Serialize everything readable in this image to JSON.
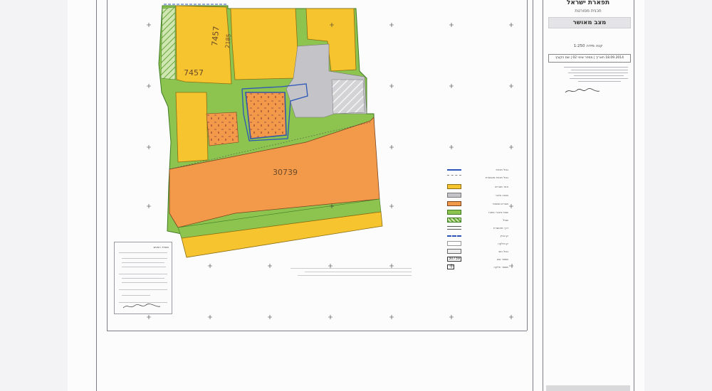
{
  "title_block": {
    "country": "תפארת ישראל",
    "plan_type": "תכנית מפורטת",
    "status": "מצב מאושר",
    "scale": "קנה מידה 1:250",
    "date_row": "18.09.2014 תאריך | מספר שינוי 02 | שם הקובץ"
  },
  "map": {
    "parcels": [
      "7457",
      "7457",
      "2185",
      "30739"
    ],
    "land_use_colors": {
      "residential": "#f5c52e",
      "public": "#c4c4c7",
      "mixed": "#f5993d",
      "open_space": "#88c34a"
    }
  },
  "legend": {
    "items": [
      {
        "label": "גבול תכנית",
        "icon": "blue-line"
      },
      {
        "label": "גבול תכנית מאושרת",
        "icon": "hatch"
      },
      {
        "label": "אזור מגורים",
        "icon": "yellow-fill"
      },
      {
        "label": "מבנה ציבור",
        "icon": "gray-fill"
      },
      {
        "label": "מגורים ומסחר",
        "icon": "orange-fill"
      },
      {
        "label": "שטח ציבורי פתוח",
        "icon": "green-fill"
      },
      {
        "label": "שביל",
        "icon": "hatch-green"
      },
      {
        "label": "דרך מאושרת",
        "icon": "double-line"
      },
      {
        "label": "קו בניין",
        "icon": "dash-line"
      },
      {
        "label": "קו חלקה",
        "icon": "thin-line"
      },
      {
        "label": "גבול גוש",
        "icon": "gray-box"
      },
      {
        "label": "מספר גוש",
        "icon": "box-30739",
        "value": "30739"
      },
      {
        "label": "מספר חלקה",
        "icon": "box-small"
      }
    ]
  },
  "notes": {
    "title": "משרד הפנים"
  }
}
